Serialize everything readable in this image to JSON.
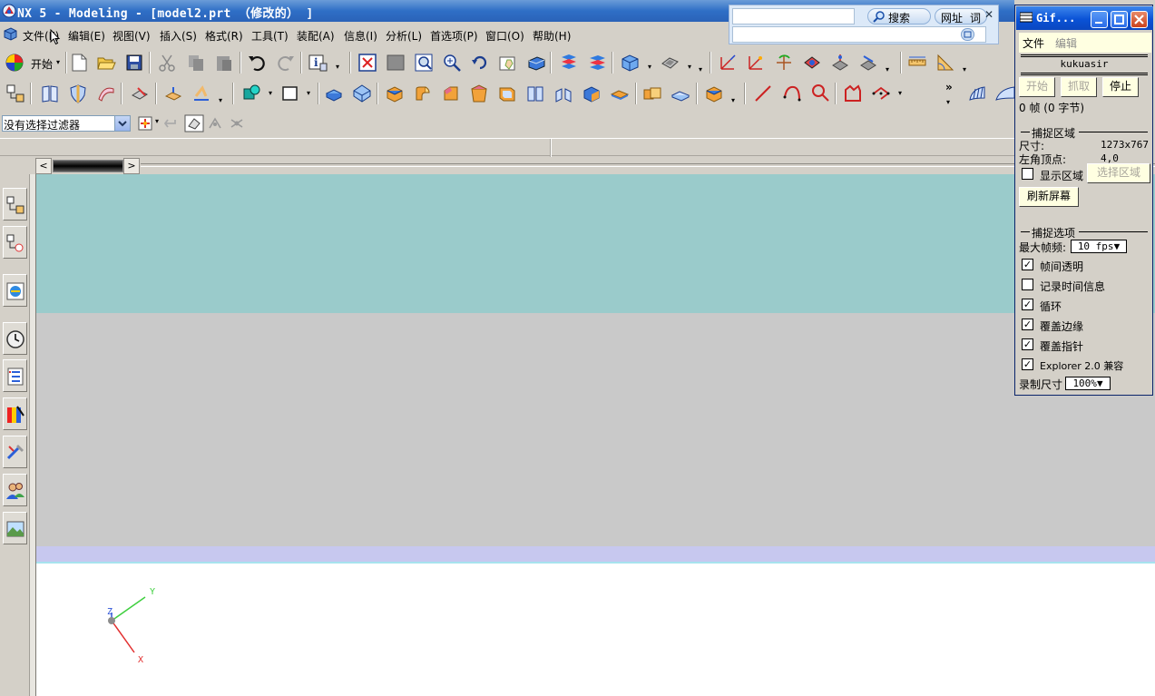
{
  "window": {
    "title": "NX 5 - Modeling - [model2.prt （修改的） ]"
  },
  "menubar": {
    "items": [
      "文件(F)",
      "编辑(E)",
      "视图(V)",
      "插入(S)",
      "格式(R)",
      "工具(T)",
      "装配(A)",
      "信息(I)",
      "分析(L)",
      "首选项(P)",
      "窗口(O)",
      "帮助(H)"
    ]
  },
  "ie_bar": {
    "search_label": "搜索",
    "url_label": "网址",
    "ci_label": "词"
  },
  "toolbar1": {
    "start_label": "开始"
  },
  "filterbar": {
    "filter_value": "没有选择过滤器"
  },
  "triad": {
    "x": "X",
    "y": "Y",
    "z": "Z"
  },
  "colors": {
    "title_bar": "#2f6fc6",
    "viewport_top": "#9acbcb",
    "viewport_mid": "#c9c9c9",
    "viewport_band": "#c7c8ef",
    "viewport_bottom": "#ffffff",
    "axis_x": "#e23030",
    "axis_y": "#3fcf3f",
    "axis_z": "#3055d8"
  },
  "gifcam": {
    "title": "Gif...",
    "menu": {
      "file": "文件",
      "edit": "编辑"
    },
    "user": "kukuasir",
    "buttons": {
      "start": "开始",
      "grab": "抓取",
      "stop": "停止"
    },
    "frames_info": "0 帧 (0 字节)",
    "capture_area": {
      "header": "捕捉区域",
      "size_label": "尺寸:",
      "size_value": "1273x767",
      "corner_label": "左角顶点:",
      "corner_value": "4,0",
      "show_area_label": "显示区域",
      "show_area_checked": false,
      "select_area_button": "选择区域",
      "refresh_button": "刷新屏幕"
    },
    "capture_options": {
      "header": "捕捉选项",
      "max_fps_label": "最大帧频:",
      "max_fps_value": "10 fps",
      "options": [
        {
          "label": "帧间透明",
          "checked": true
        },
        {
          "label": "记录时间信息",
          "checked": false
        },
        {
          "label": "循环",
          "checked": true
        },
        {
          "label": "覆盖边缘",
          "checked": true
        },
        {
          "label": "覆盖指针",
          "checked": true
        },
        {
          "label": "Explorer 2.0 兼容",
          "checked": true
        }
      ],
      "record_size_label": "录制尺寸",
      "record_size_value": "100%"
    }
  }
}
